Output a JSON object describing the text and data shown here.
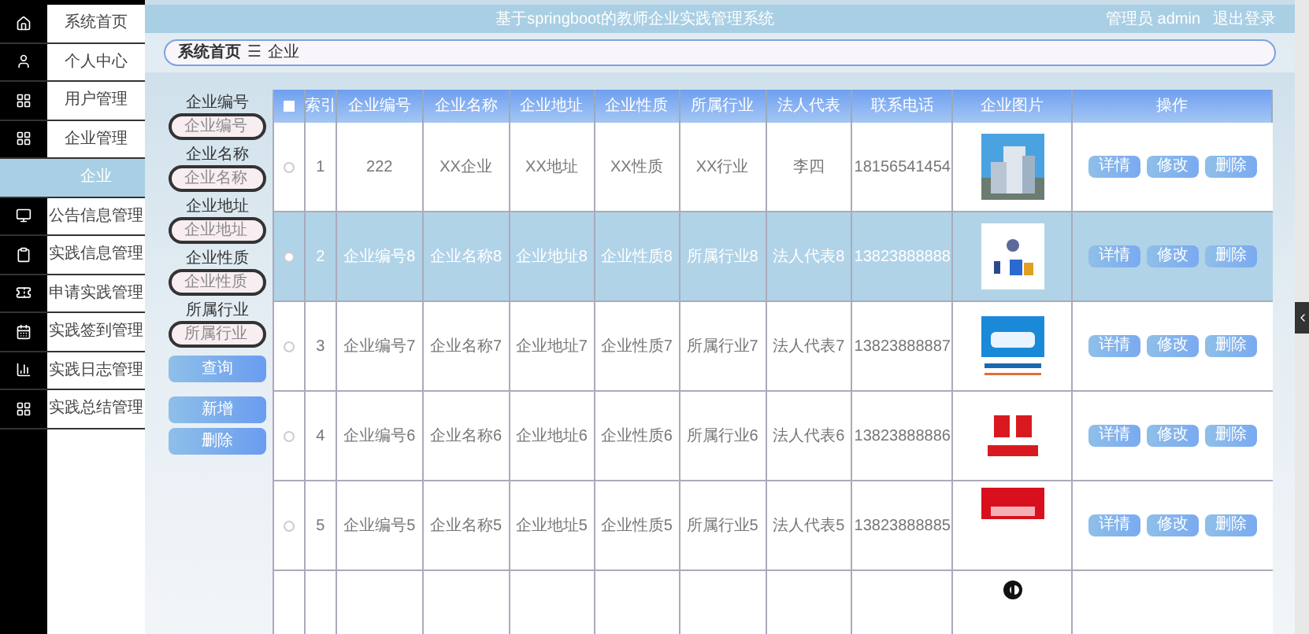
{
  "sidebar": {
    "items": [
      {
        "label": "系统首页",
        "selected": false
      },
      {
        "label": "个人中心",
        "selected": false
      },
      {
        "label": "用户管理",
        "selected": false
      },
      {
        "label": "企业管理",
        "selected": false
      },
      {
        "label": "企业",
        "selected": true
      },
      {
        "label": "公告信息管理",
        "selected": false
      },
      {
        "label": "实践信息管理",
        "selected": false
      },
      {
        "label": "申请实践管理",
        "selected": false
      },
      {
        "label": "实践签到管理",
        "selected": false
      },
      {
        "label": "实践日志管理",
        "selected": false
      },
      {
        "label": "实践总结管理",
        "selected": false
      }
    ]
  },
  "header": {
    "title": "基于springboot的教师企业实践管理系统",
    "user": "管理员 admin",
    "logout": "退出登录"
  },
  "breadcrumb": {
    "home": "系统首页",
    "separator": "☰",
    "current": "企业"
  },
  "search": {
    "fields": [
      {
        "label": "企业编号",
        "placeholder": "企业编号"
      },
      {
        "label": "企业名称",
        "placeholder": "企业名称"
      },
      {
        "label": "企业地址",
        "placeholder": "企业地址"
      },
      {
        "label": "企业性质",
        "placeholder": "企业性质"
      },
      {
        "label": "所属行业",
        "placeholder": "所属行业"
      }
    ],
    "query_button": "查询",
    "add_button": "新增",
    "delete_button": "删除"
  },
  "table": {
    "select_all_checked": false,
    "columns": [
      "索引",
      "企业编号",
      "企业名称",
      "企业地址",
      "企业性质",
      "所属行业",
      "法人代表",
      "联系电话",
      "企业图片",
      "操作"
    ],
    "rows": [
      {
        "selected": false,
        "cells": [
          "1",
          "222",
          "XX企业",
          "XX地址",
          "XX性质",
          "XX行业",
          "李四",
          "18156541454"
        ],
        "actions": [
          "详情",
          "修改",
          "删除"
        ]
      },
      {
        "selected": true,
        "cells": [
          "2",
          "企业编号8",
          "企业名称8",
          "企业地址8",
          "企业性质8",
          "所属行业8",
          "法人代表8",
          "13823888888"
        ],
        "actions": [
          "详情",
          "修改",
          "删除"
        ]
      },
      {
        "selected": false,
        "cells": [
          "3",
          "企业编号7",
          "企业名称7",
          "企业地址7",
          "企业性质7",
          "所属行业7",
          "法人代表7",
          "13823888887"
        ],
        "actions": [
          "详情",
          "修改",
          "删除"
        ]
      },
      {
        "selected": false,
        "cells": [
          "4",
          "企业编号6",
          "企业名称6",
          "企业地址6",
          "企业性质6",
          "所属行业6",
          "法人代表6",
          "13823888886"
        ],
        "actions": [
          "详情",
          "修改",
          "删除"
        ]
      },
      {
        "selected": false,
        "cells": [
          "5",
          "企业编号5",
          "企业名称5",
          "企业地址5",
          "企业性质5",
          "所属行业5",
          "法人代表5",
          "13823888885"
        ],
        "actions": [
          "详情",
          "修改",
          "删除"
        ]
      }
    ]
  }
}
